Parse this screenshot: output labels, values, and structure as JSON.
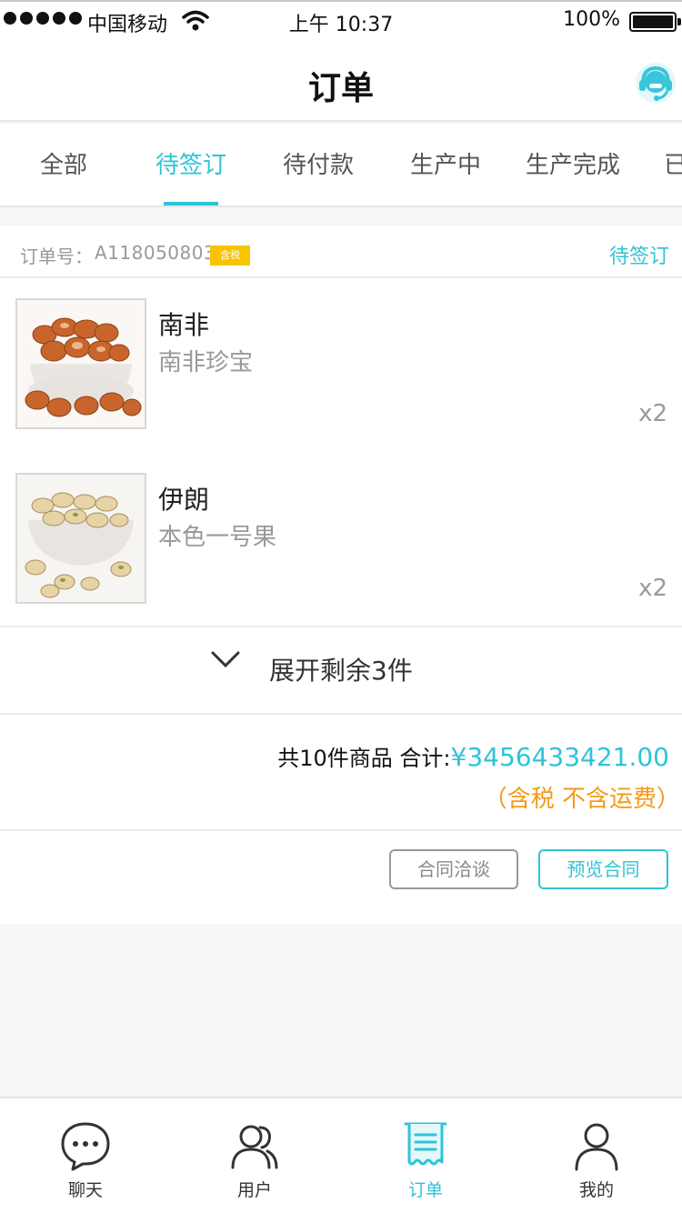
{
  "status_bar": {
    "carrier": "中国移动",
    "time": "上午 10:37",
    "battery": "100%"
  },
  "nav": {
    "title": "订单",
    "support_icon": "headset-icon"
  },
  "tabs": [
    {
      "label": "全部"
    },
    {
      "label": "待签订",
      "active": true
    },
    {
      "label": "待付款"
    },
    {
      "label": "生产中"
    },
    {
      "label": "生产完成"
    },
    {
      "label": "已"
    }
  ],
  "order": {
    "number_label": "订单号：",
    "number": "A1180508031",
    "tax_badge": "含税",
    "status": "待签订",
    "products": [
      {
        "name": "南非",
        "spec": "南非珍宝",
        "qty": "x2"
      },
      {
        "name": "伊朗",
        "spec": "本色一号果",
        "qty": "x2"
      }
    ],
    "expand_label": "展开剩余3件",
    "count_text": "共10件商品 合计:",
    "total": "¥3456433421.00",
    "tax_note": "（含税 不含运费）",
    "actions": {
      "negotiate": "合同洽谈",
      "preview": "预览合同"
    }
  },
  "tab_bar": [
    {
      "label": "聊天",
      "icon": "chat-icon"
    },
    {
      "label": "用户",
      "icon": "users-icon"
    },
    {
      "label": "订单",
      "icon": "order-icon",
      "active": true
    },
    {
      "label": "我的",
      "icon": "profile-icon"
    }
  ],
  "colors": {
    "accent": "#2ec4d6",
    "warning": "#f39a1a",
    "badge": "#f7c500"
  }
}
